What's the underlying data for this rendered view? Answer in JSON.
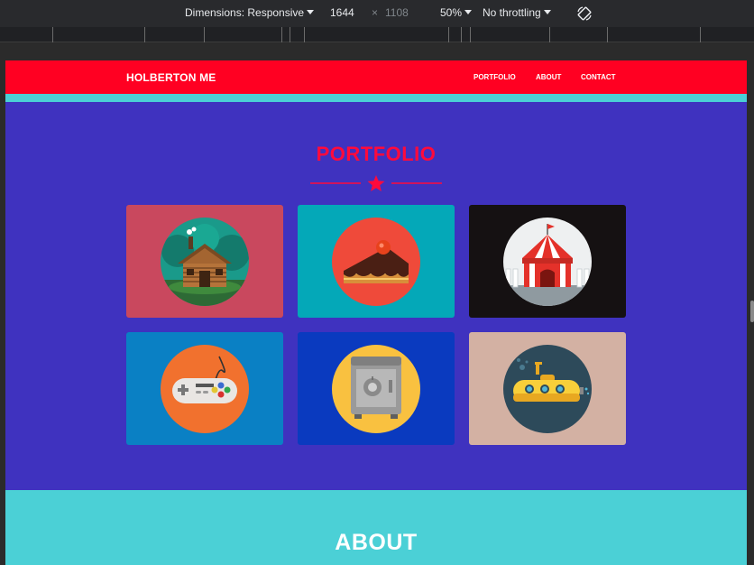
{
  "devtools": {
    "dimensions_label": "Dimensions: Responsive",
    "width": "1644",
    "times": "×",
    "height": "1108",
    "zoom": "50%",
    "throttling": "No throttling",
    "rotate_icon": "rotate-icon"
  },
  "site": {
    "brand": "HOLBERTON ME",
    "nav": [
      "PORTFOLIO",
      "ABOUT",
      "CONTACT"
    ],
    "colors": {
      "nav": "#ff0022",
      "accent": "#4bd0d6",
      "portfolio_bg": "#3f32bf",
      "title": "#ff0a3c"
    }
  },
  "portfolio": {
    "title": "PORTFOLIO",
    "divider_icon": "star-icon",
    "tiles": [
      {
        "icon": "cabin-icon",
        "bg": "#c9485e"
      },
      {
        "icon": "cake-icon",
        "bg": "#04a8b8"
      },
      {
        "icon": "circus-tent-icon",
        "bg": "#151112"
      },
      {
        "icon": "gamepad-icon",
        "bg": "#0a80c4"
      },
      {
        "icon": "safe-icon",
        "bg": "#0a3abf"
      },
      {
        "icon": "submarine-icon",
        "bg": "#d3b1a3"
      }
    ]
  },
  "about": {
    "title": "ABOUT"
  }
}
